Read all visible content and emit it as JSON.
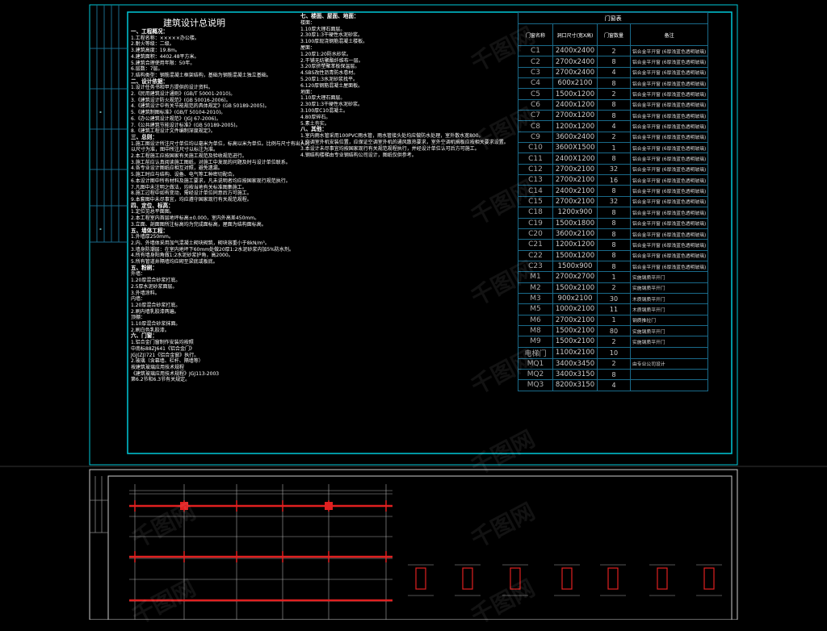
{
  "doc_title": "建筑设计总说明",
  "watermark": "千图网",
  "notes_left": [
    {
      "t": "一、工程概况：",
      "h": true
    },
    {
      "t": "1.工程名称：×××××办公楼。"
    },
    {
      "t": "2.耐火等级：二级。"
    },
    {
      "t": "3.建筑高度：19.8m。"
    },
    {
      "t": "4.建筑面积：4402.48平方米。"
    },
    {
      "t": "5.建筑合理使用年限：50年。"
    },
    {
      "t": "6.层数：7层。"
    },
    {
      "t": "7.结构类型：钢筋混凝土框架结构，基础为钢筋混凝土独立基础。"
    },
    {
      "t": "二、设计依据：",
      "h": true
    },
    {
      "t": "1.设计任务书和甲方提供的设计资料。"
    },
    {
      "t": "2.《民用建筑设计通则》(GB/T 50001-2010)。"
    },
    {
      "t": "3.《建筑设计防火规范》(GB 50016-2006)。"
    },
    {
      "t": "4.《建筑设计中有关节能规范的具体规定》(GB 50189-2005)。"
    },
    {
      "t": "5.《建筑制图标准》(GB/T 50104-2010)。"
    },
    {
      "t": "6.《办公建筑设计规范》(JGJ 67-2006)。"
    },
    {
      "t": "7.《公共建筑节能设计标准》(GB 50189-2005)。"
    },
    {
      "t": "8.《建筑工程设计文件编制深度规定》。"
    },
    {
      "t": "三、总则：",
      "h": true
    },
    {
      "t": "1.施工图设计所注尺寸单位均以毫米为单位，标高以米为单位。比例与尺寸有出入时"
    },
    {
      "t": "以尺寸为准，图中所注尺寸以标注为准。"
    },
    {
      "t": "2.本工程施工应按国家有关施工规范及验收规范进行。"
    },
    {
      "t": "3.施工前应认真阅读施工图纸，对施工中发现的问题及时与设计单位联系。"
    },
    {
      "t": "4.各专业设计图纸应相互对照，避免遗漏。"
    },
    {
      "t": "5.施工时应与结构、设备、电气等工种密切配合。"
    },
    {
      "t": "6.本设计图中所有材料及施工要求，凡未说明者均应按国家现行规范执行。"
    },
    {
      "t": "7.凡图中未注明之做法，均按当地有关标准图集施工。"
    },
    {
      "t": "8.施工过程中如有变动，需经设计单位同意后方可施工。"
    },
    {
      "t": "9.本套图中未尽事宜，均应遵守国家现行有关规范规程。"
    },
    {
      "t": "四、定位、标高：",
      "h": true
    },
    {
      "t": "1.定位见总平面图。"
    },
    {
      "t": "2.本工程室内首层地坪标高±0.000，室内外高差450mm。"
    },
    {
      "t": "3.立面、剖面图所注标高均为完成面标高，屋面为结构面标高。"
    },
    {
      "t": "五、墙体工程：",
      "h": true
    },
    {
      "t": "1.外墙厚250mm。"
    },
    {
      "t": "2.内、外墙体采用加气混凝土砌块砌筑，砌块容重小于8kN/m³。"
    },
    {
      "t": "3.墙身防潮层：在室内地坪下60mm处做20厚1:2水泥砂浆内加5%防水剂。"
    },
    {
      "t": "4.所有墙身阳角做1:2水泥砂浆护角，高2000。"
    },
    {
      "t": "5.所有管道井隔墙均应砌至梁底或板底。"
    },
    {
      "t": "五、粉刷：",
      "h": true
    },
    {
      "t": "外墙："
    },
    {
      "t": "1.20厚混合砂浆打底。"
    },
    {
      "t": "2.5厚水泥砂浆面层。"
    },
    {
      "t": "3.外墙涂料。"
    },
    {
      "t": "内墙："
    },
    {
      "t": "1.20厚混合砂浆打底。"
    },
    {
      "t": "2.刷内墙乳胶漆两遍。"
    },
    {
      "t": "顶棚："
    },
    {
      "t": "1.10厚混合砂浆抹面。"
    },
    {
      "t": "2.刷白色乳胶漆。"
    },
    {
      "t": "六、门窗：",
      "h": true
    },
    {
      "t": "1.铝合金门窗制作安装均按照"
    },
    {
      "t": "中南标88ZJ641《铝合金门》"
    },
    {
      "t": "JGJ(ZJ)721《铝合金窗》执行。"
    },
    {
      "t": "2.玻璃（含幕墙、栏杆、隔墙等）"
    },
    {
      "t": "按建筑玻璃应用技术规程"
    },
    {
      "t": "《建筑玻璃应用技术规程》JGJ113-2003"
    },
    {
      "t": "第6.2节和6.3节有关规定。"
    }
  ],
  "notes_right": [
    {
      "t": "七、楼面、屋面、地面：",
      "h": true
    },
    {
      "t": "楼面："
    },
    {
      "t": "1.10厚大理石面层。"
    },
    {
      "t": "2.30厚1:3干硬性水泥砂浆。"
    },
    {
      "t": "3.100厚现浇钢筋混凝土楼板。"
    },
    {
      "t": "屋面："
    },
    {
      "t": "1.20厚1:20防水砂浆。"
    },
    {
      "t": "2.干铺无纺聚酯纤维布一层。"
    },
    {
      "t": "3.20厚挤塑聚苯板保温层。"
    },
    {
      "t": "4.SBS改性沥青防水卷材。"
    },
    {
      "t": "5.20厚1:3水泥砂浆找平。"
    },
    {
      "t": "6.120厚钢筋混凝土屋面板。"
    },
    {
      "t": "地面："
    },
    {
      "t": "1.10厚大理石面层。"
    },
    {
      "t": "2.30厚1:3干硬性水泥砂浆。"
    },
    {
      "t": "3.100厚C10混凝土。"
    },
    {
      "t": "4.80厚碎石。"
    },
    {
      "t": "5.素土夯实。"
    },
    {
      "t": "八、其他：",
      "h": true
    },
    {
      "t": "1.室内雨水管采用100PVC雨水管，雨水管接头处均应做防水处理，室外散水宽800。"
    },
    {
      "t": "2.空调室外机安装位置，应保证空调室外机的通风散热要求，室外空调机搁板应按相关要求设置。"
    },
    {
      "t": "3.本设计未尽事宜均按国家现行有关规范规程执行，并经设计单位认可后方可施工。"
    },
    {
      "t": "4.钢结构楼梯由专业钢结构公司设计，图纸仅供参考。"
    }
  ],
  "schedule": {
    "title": "门窗表",
    "headers": [
      "门窗名称",
      "洞口尺寸(宽X高)",
      "门窗数量",
      "备注"
    ],
    "rows": [
      [
        "C1",
        "2400x2400",
        "2",
        "铝合金平开窗  (6厚浅蓝色透明玻璃)"
      ],
      [
        "C2",
        "2700x2400",
        "8",
        "铝合金平开窗  (6厚浅蓝色透明玻璃)"
      ],
      [
        "C3",
        "2700x2400",
        "4",
        "铝合金平开窗  (6厚浅蓝色透明玻璃)"
      ],
      [
        "C4",
        "600x2100",
        "8",
        "铝合金平开窗  (6厚浅蓝色透明玻璃)"
      ],
      [
        "C5",
        "1500x1200",
        "2",
        "铝合金平开窗  (6厚浅蓝色透明玻璃)"
      ],
      [
        "C6",
        "2400x1200",
        "8",
        "铝合金平开窗  (6厚浅蓝色透明玻璃)"
      ],
      [
        "C7",
        "2700x1200",
        "8",
        "铝合金平开窗  (6厚浅蓝色透明玻璃)"
      ],
      [
        "C8",
        "1200x1200",
        "4",
        "铝合金平开窗  (6厚浅蓝色透明玻璃)"
      ],
      [
        "C9",
        "3600x2400",
        "2",
        "铝合金平开窗  (6厚浅蓝色透明玻璃)"
      ],
      [
        "C10",
        "3600X1500",
        "1",
        "铝合金平开窗  (6厚浅蓝色透明玻璃)"
      ],
      [
        "C11",
        "2400X1200",
        "8",
        "铝合金平开窗  (6厚浅蓝色透明玻璃)"
      ],
      [
        "C12",
        "2700x2100",
        "32",
        "铝合金平开窗  (6厚浅蓝色透明玻璃)"
      ],
      [
        "C13",
        "2700x2100",
        "16",
        "铝合金平开窗  (6厚浅蓝色透明玻璃)"
      ],
      [
        "C14",
        "2400x2100",
        "8",
        "铝合金平开窗  (6厚浅蓝色透明玻璃)"
      ],
      [
        "C15",
        "2700x2100",
        "32",
        "铝合金平开窗  (6厚浅蓝色透明玻璃)"
      ],
      [
        "C18",
        "1200x900",
        "8",
        "铝合金平开窗  (6厚浅蓝色透明玻璃)"
      ],
      [
        "C19",
        "1500x1800",
        "8",
        "铝合金平开窗  (6厚浅蓝色透明玻璃)"
      ],
      [
        "C20",
        "3600x2100",
        "8",
        "铝合金平开窗  (6厚浅蓝色透明玻璃)"
      ],
      [
        "C21",
        "1200x1200",
        "8",
        "铝合金平开窗  (6厚浅蓝色透明玻璃)"
      ],
      [
        "C22",
        "1500x1200",
        "8",
        "铝合金平开窗  (6厚浅蓝色透明玻璃)"
      ],
      [
        "C23",
        "1500x900",
        "8",
        "铝合金平开窗  (6厚浅蓝色透明玻璃)"
      ],
      [
        "M1",
        "2700x2700",
        "1",
        "实施钢质平开门"
      ],
      [
        "M2",
        "1500x2100",
        "2",
        "实施钢质平开门"
      ],
      [
        "M3",
        "900x2100",
        "30",
        "木质钢质平开门"
      ],
      [
        "M5",
        "1000x2100",
        "11",
        "木质钢质平开门"
      ],
      [
        "M6",
        "2700x2100",
        "1",
        "钢质推拉门"
      ],
      [
        "M8",
        "1500x2100",
        "80",
        "实施钢质平开门"
      ],
      [
        "M9",
        "1500x2100",
        "2",
        "实施钢质平开门"
      ],
      [
        "电梯门",
        "1100x2100",
        "10",
        ""
      ],
      [
        "MQ1",
        "3400x3450",
        "2",
        "由专业公司设计"
      ],
      [
        "MQ2",
        "3400x3150",
        "8",
        ""
      ],
      [
        "MQ3",
        "8200x3150",
        "4",
        ""
      ]
    ]
  },
  "colors": {
    "frame": "#00c8d8",
    "grid": "#1a6a8a",
    "red": "#e02020",
    "white": "#ffffff"
  }
}
